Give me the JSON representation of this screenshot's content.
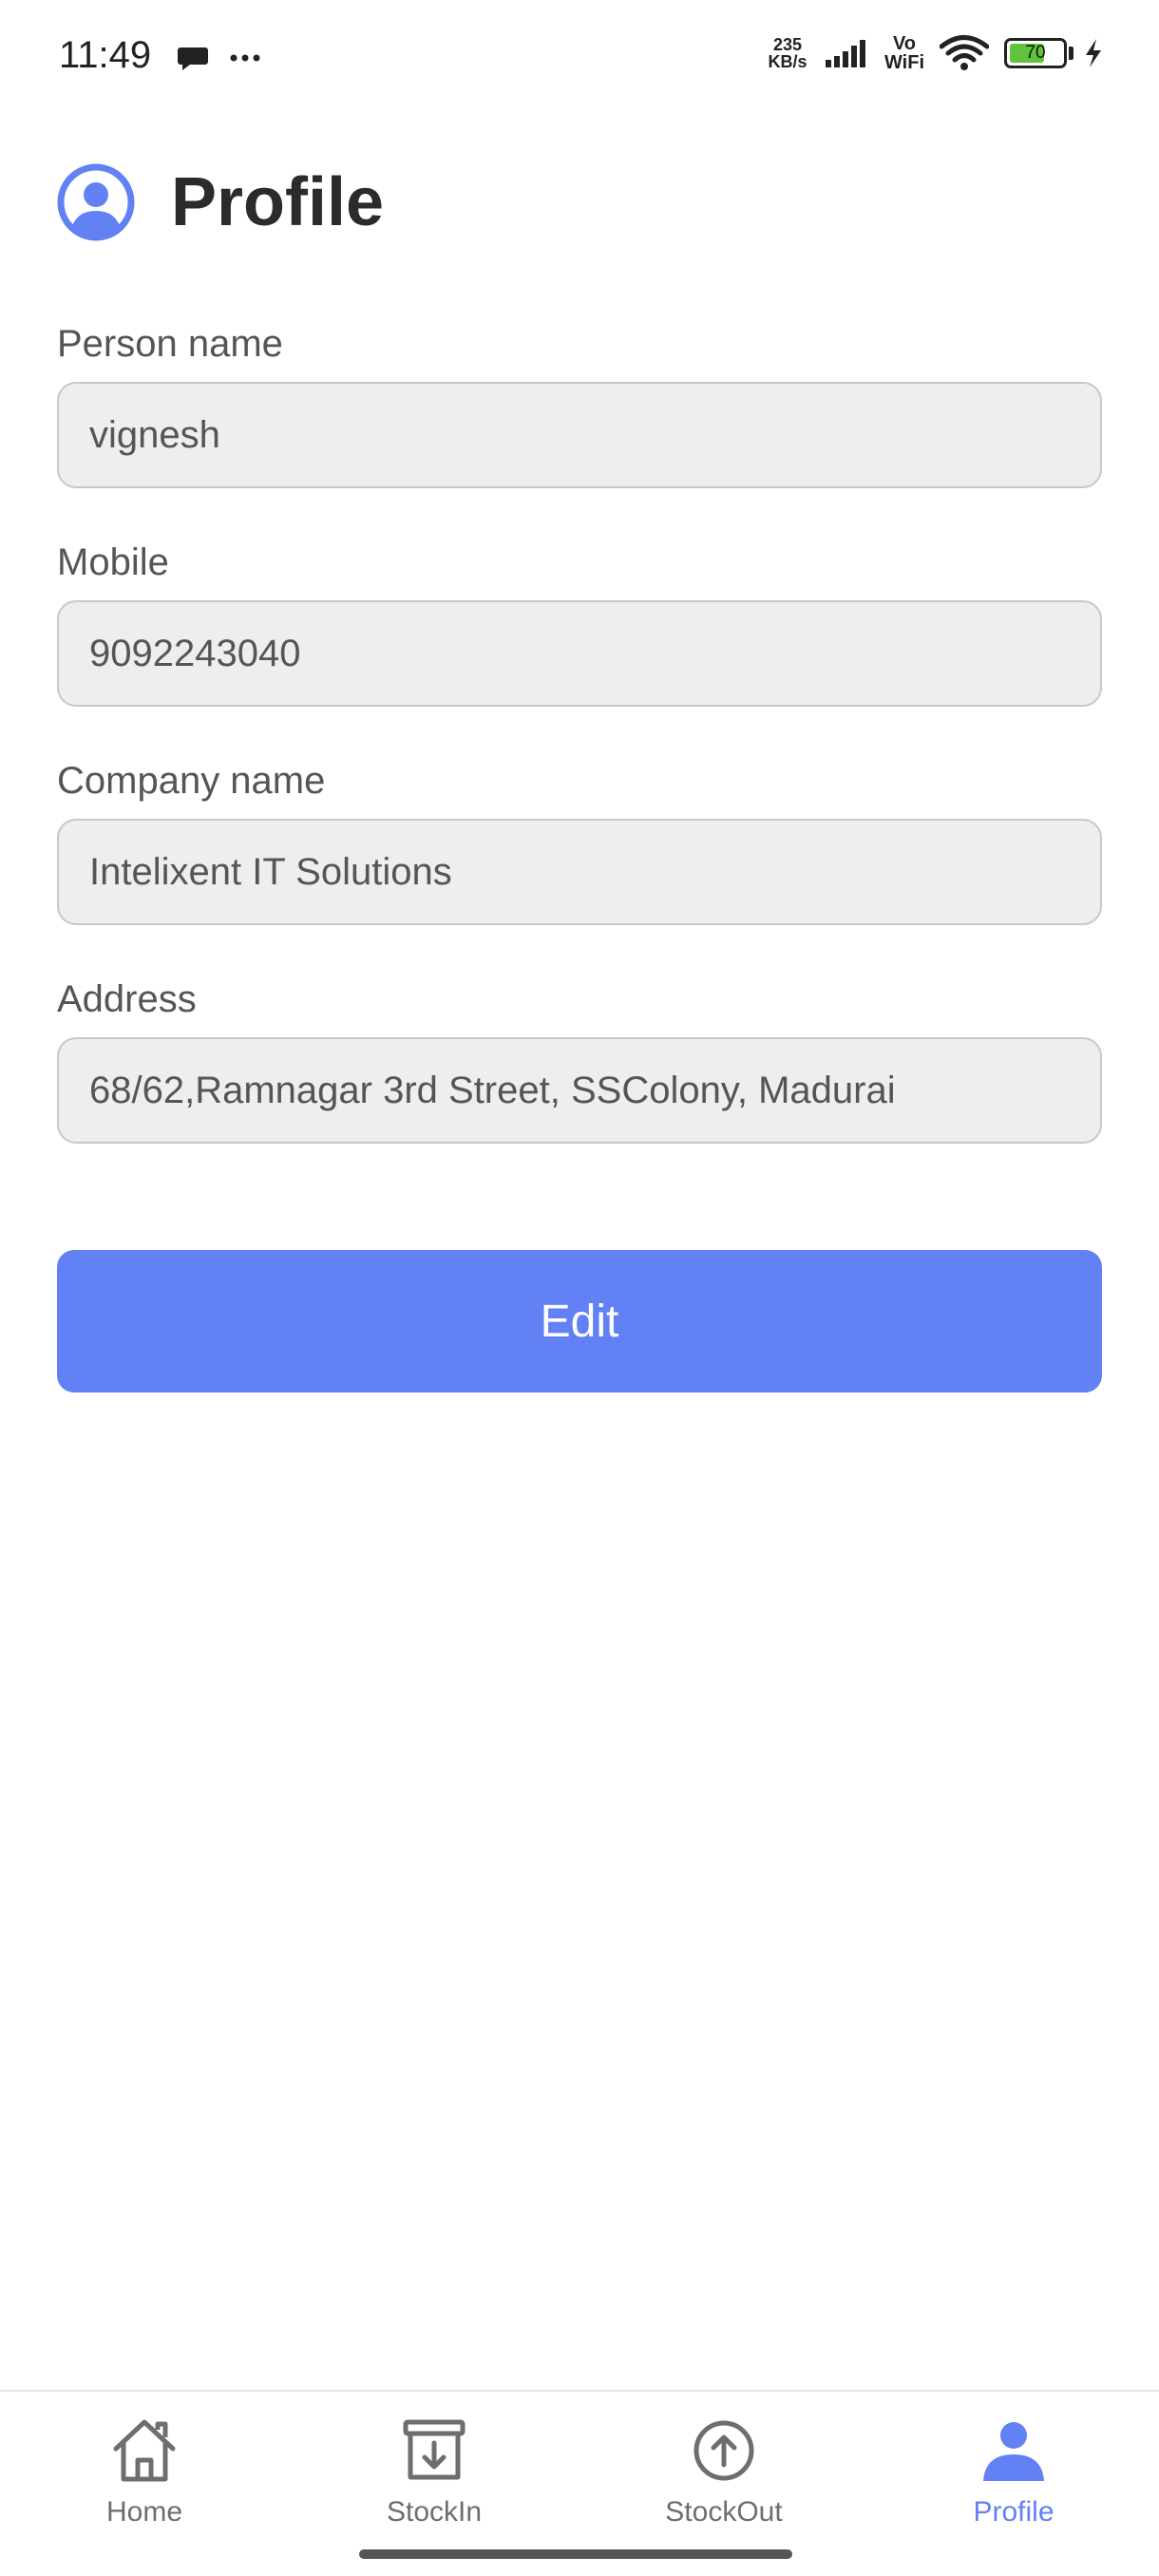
{
  "status_bar": {
    "time": "11:49",
    "net_speed_value": "235",
    "net_speed_unit": "KB/s",
    "vowifi_top": "Vo",
    "vowifi_bottom": "WiFi",
    "battery_level": "70",
    "battery_fraction": 0.7
  },
  "header": {
    "title": "Profile",
    "icon": "account-circle-icon"
  },
  "form": {
    "person_name": {
      "label": "Person name",
      "value": "vignesh"
    },
    "mobile": {
      "label": "Mobile",
      "value": "9092243040"
    },
    "company_name": {
      "label": "Company name",
      "value": "Intelixent IT Solutions"
    },
    "address": {
      "label": "Address",
      "value": "68/62,Ramnagar 3rd Street, SSColony, Madurai"
    }
  },
  "edit_button": {
    "label": "Edit"
  },
  "bottom_nav": {
    "items": [
      {
        "label": "Home",
        "icon": "home-icon",
        "active": false
      },
      {
        "label": "StockIn",
        "icon": "archive-download-icon",
        "active": false
      },
      {
        "label": "StockOut",
        "icon": "arrow-up-circle-icon",
        "active": false
      },
      {
        "label": "Profile",
        "icon": "person-icon",
        "active": true
      }
    ]
  },
  "colors": {
    "accent": "#6281f4",
    "field_bg": "#eeeeee",
    "text": "#555555",
    "title": "#2b2b2b",
    "battery": "#5fc33b"
  }
}
